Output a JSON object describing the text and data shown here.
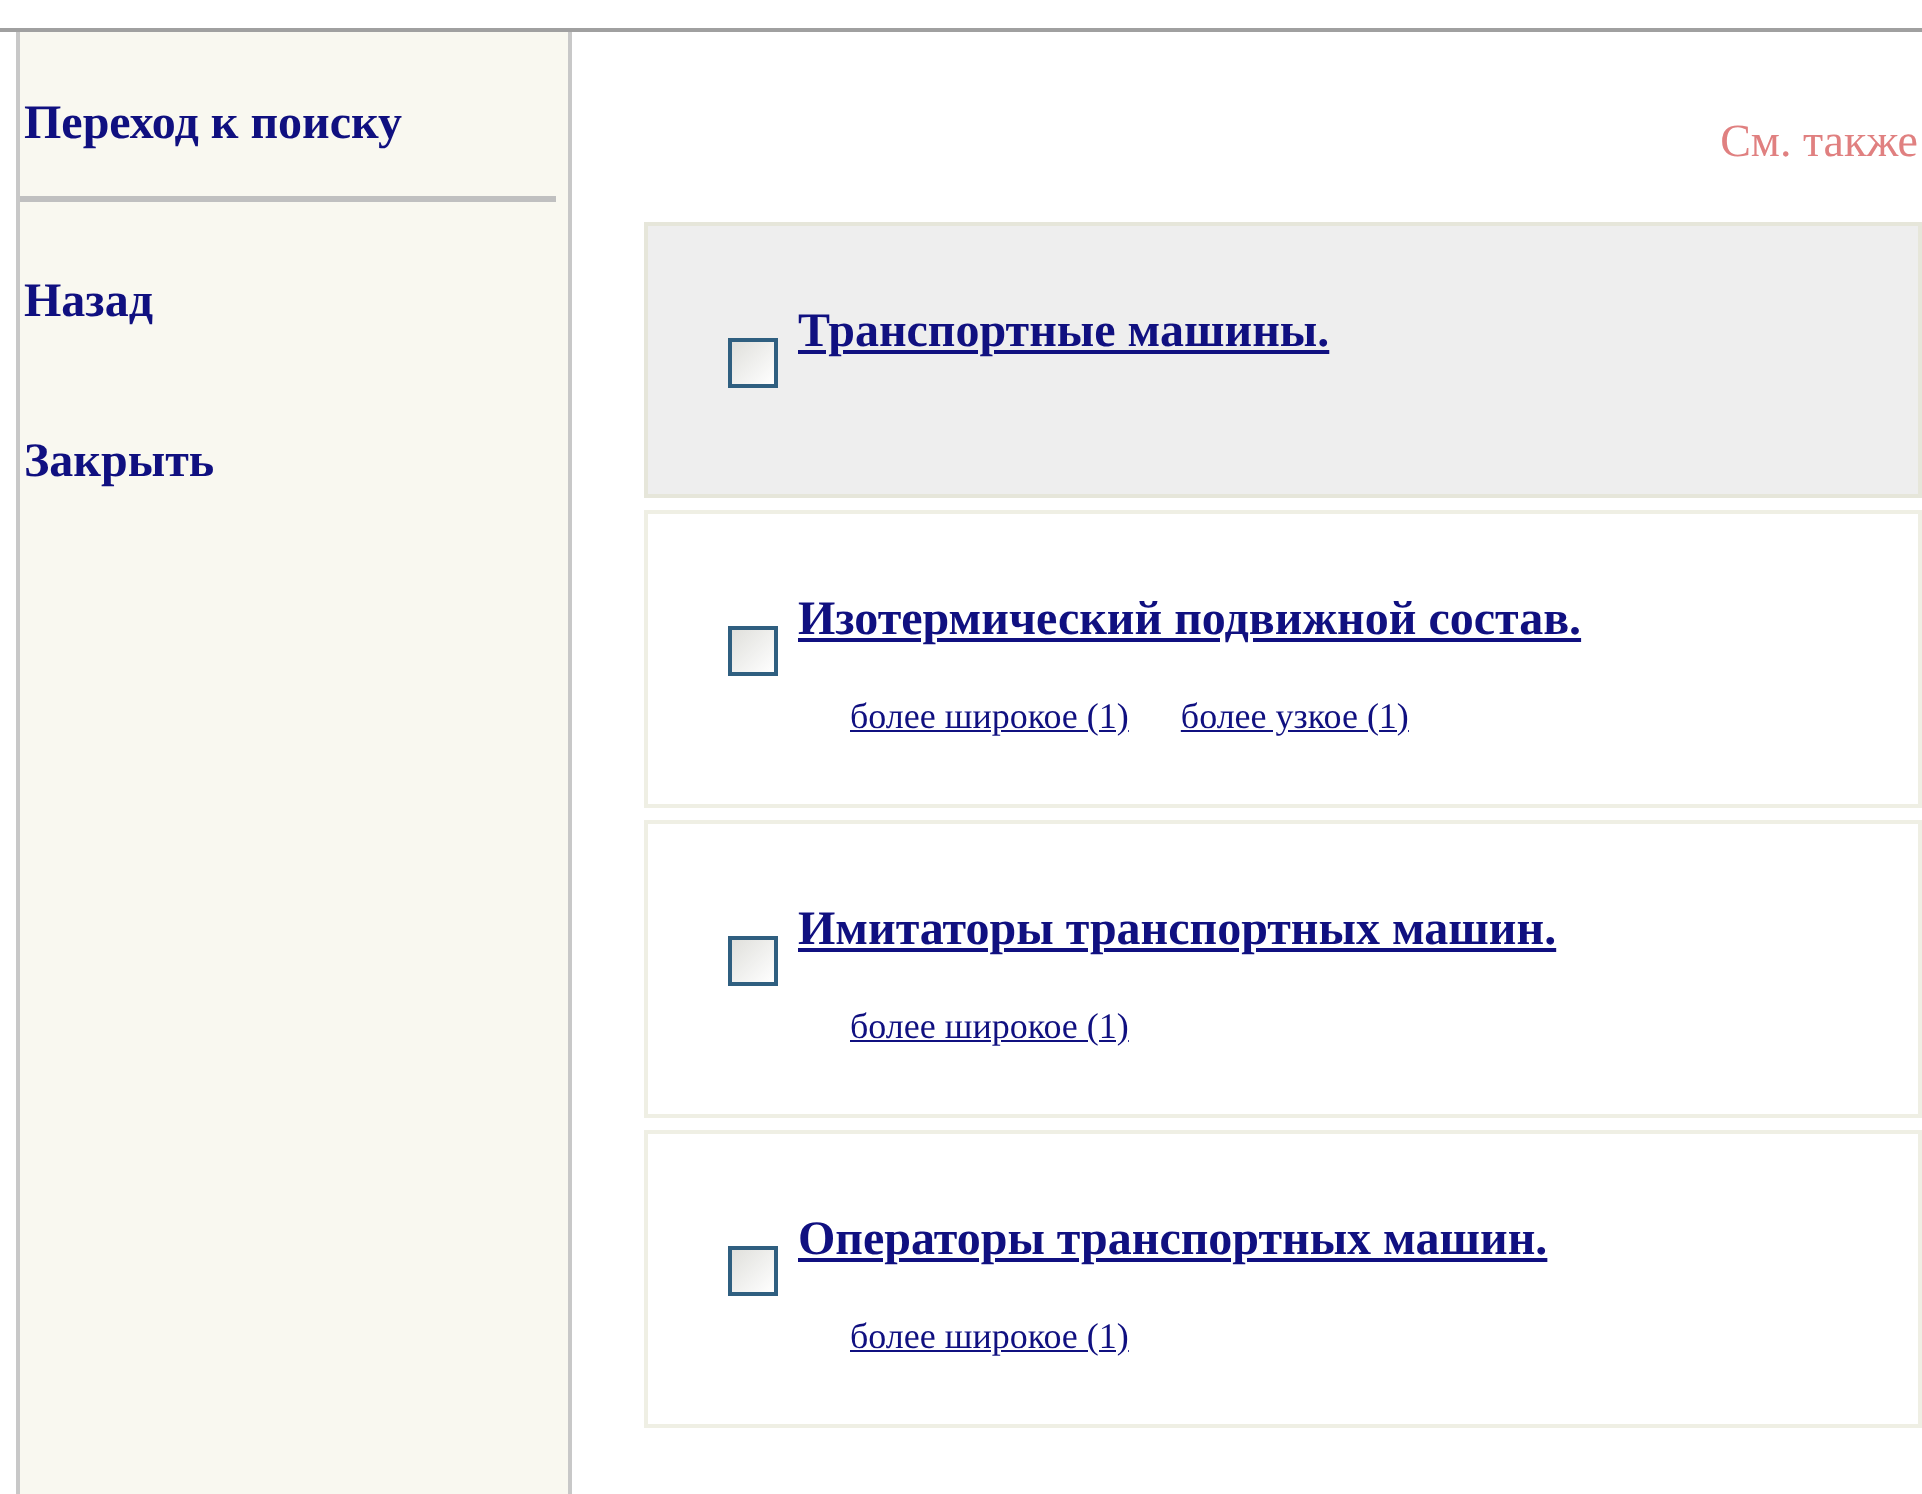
{
  "sidebar": {
    "search_link": "Переход к поиску",
    "items": [
      {
        "label": "Назад"
      },
      {
        "label": "Закрыть"
      }
    ]
  },
  "see_also": "См. также",
  "results": [
    {
      "title": "Транспортные машины.",
      "checked": false,
      "selected": true
    },
    {
      "title": "Изотермический подвижной состав.",
      "checked": false,
      "selected": false,
      "links": [
        "более широкое (1)",
        "более узкое (1)"
      ]
    },
    {
      "title": "Имитаторы транспортных машин.",
      "checked": false,
      "selected": false,
      "links": [
        "более широкое (1)"
      ]
    },
    {
      "title": "Операторы транспортных машин.",
      "checked": false,
      "selected": false,
      "links": [
        "более широкое (1)"
      ]
    }
  ]
}
